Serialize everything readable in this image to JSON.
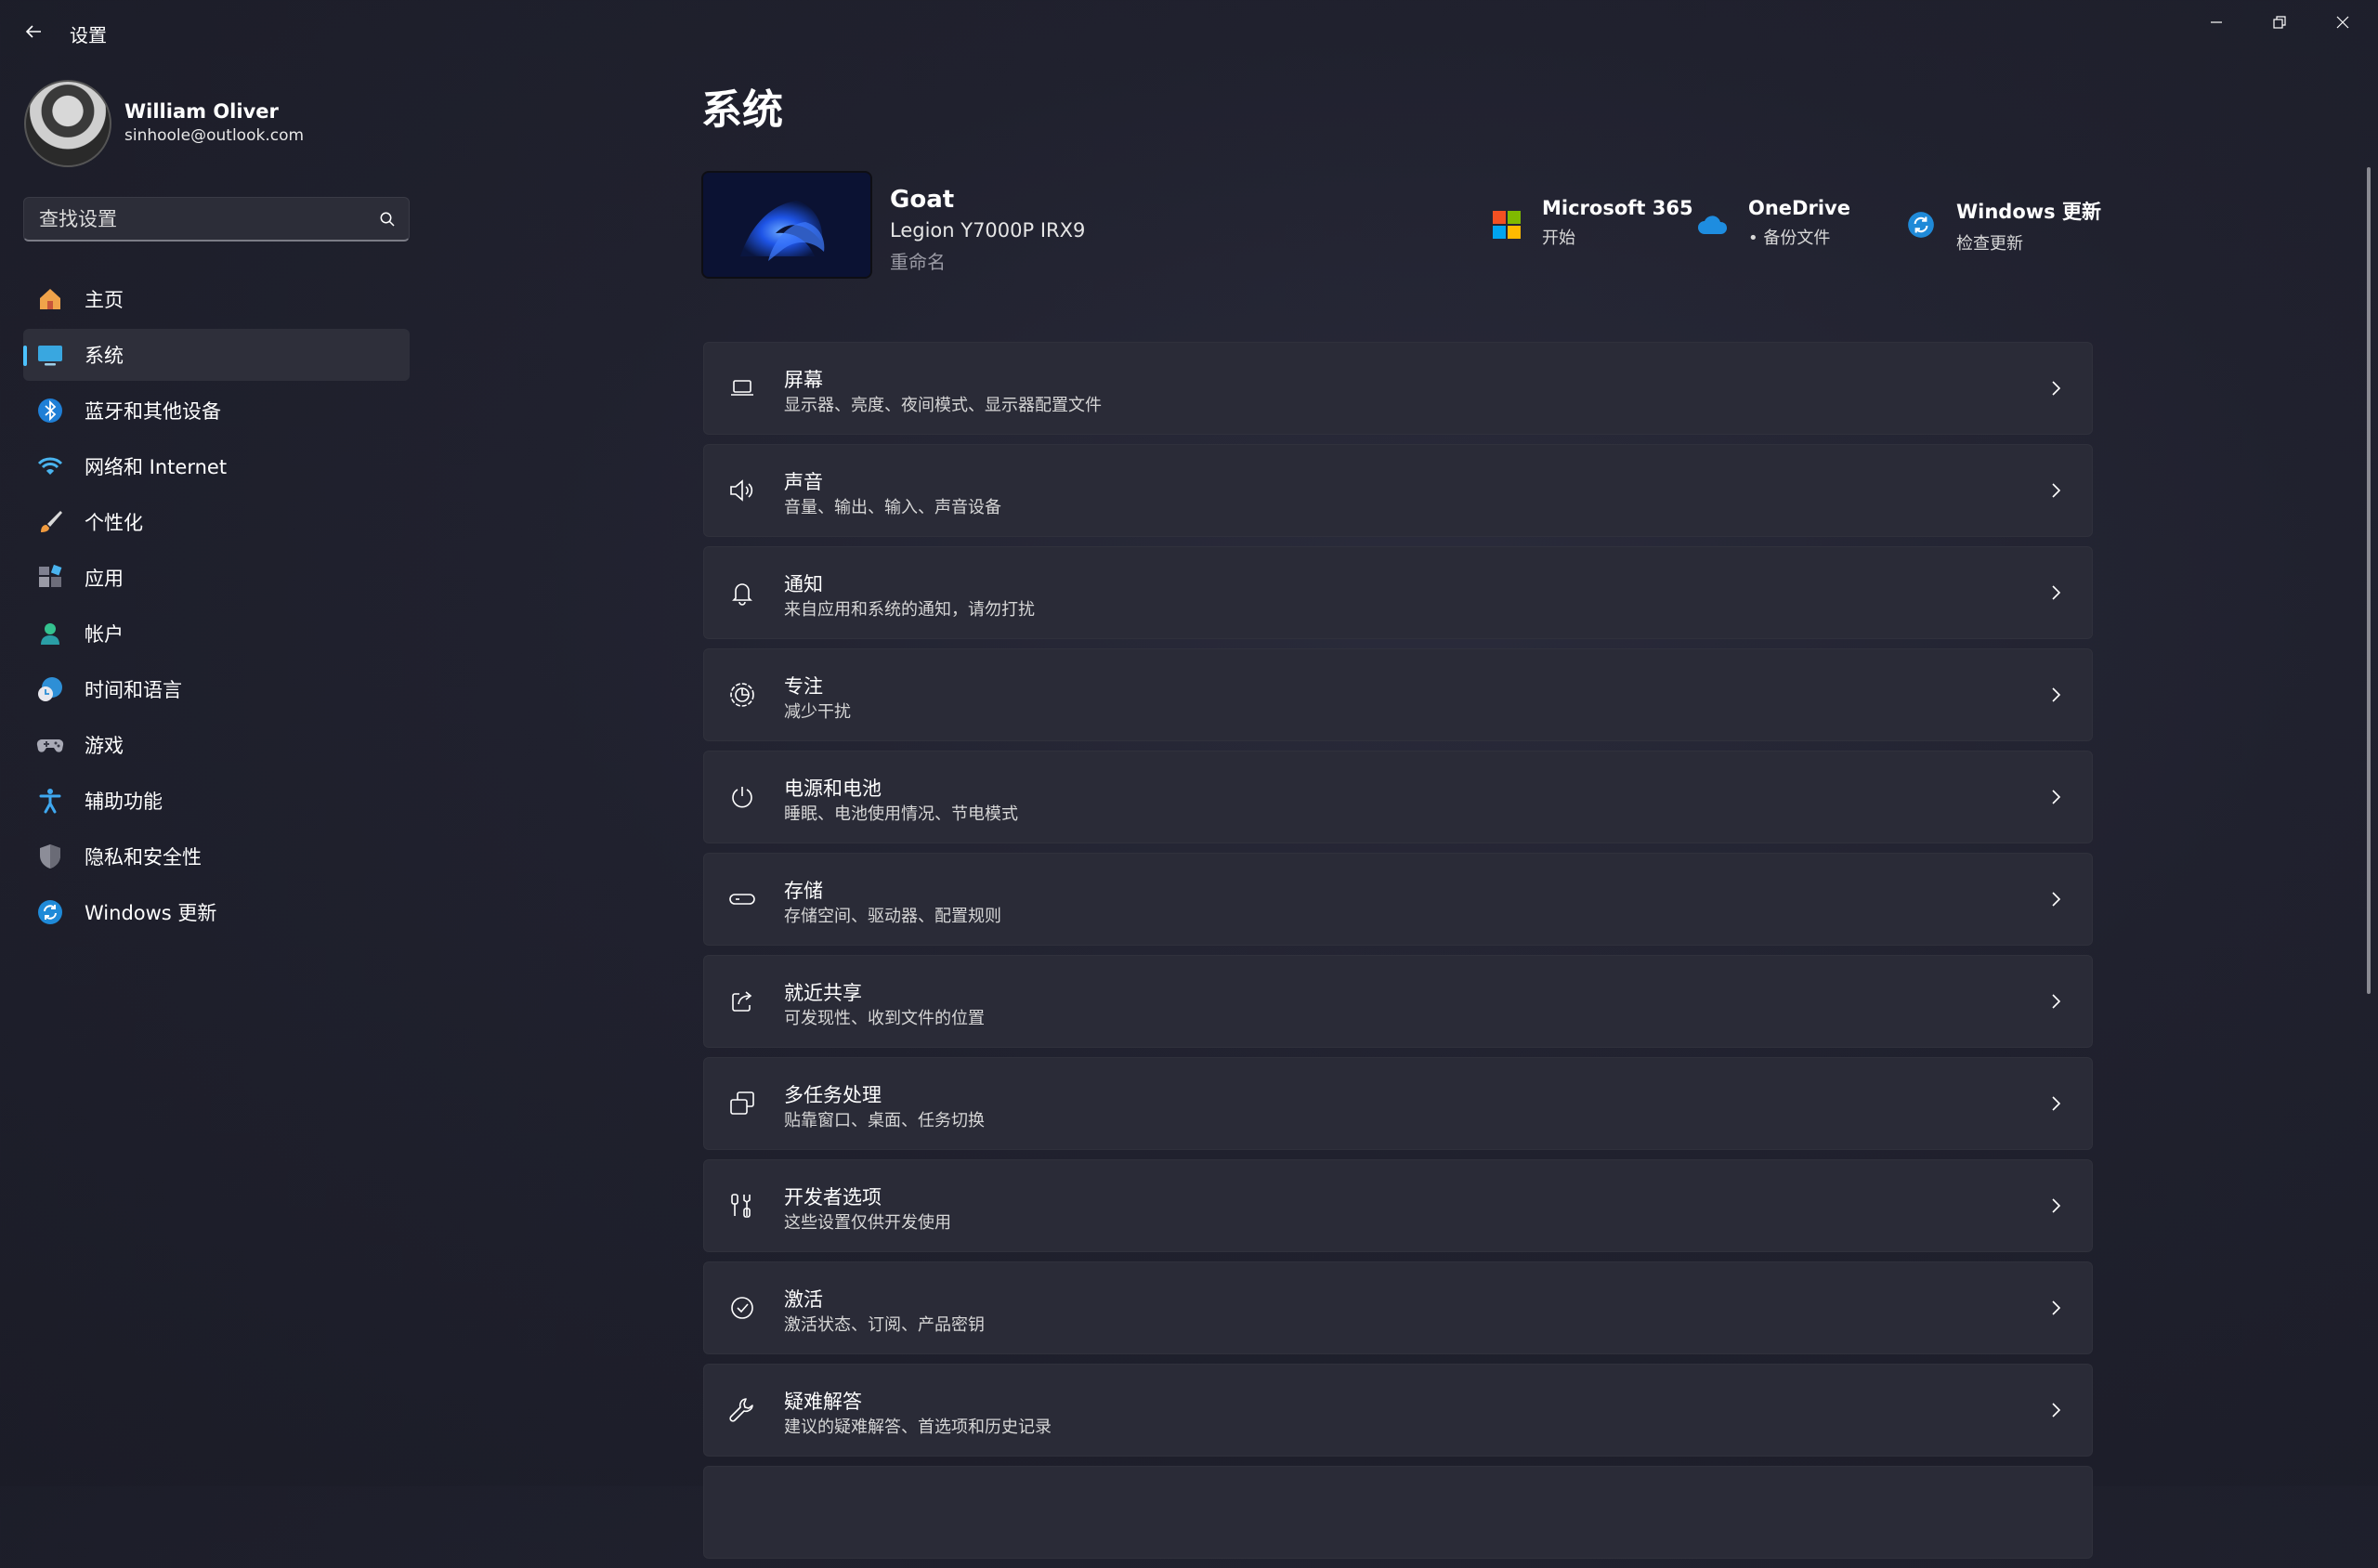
{
  "window": {
    "title": "设置",
    "back_icon": "arrow-left-icon",
    "controls": [
      "minimize-icon",
      "restore-icon",
      "close-icon"
    ]
  },
  "profile": {
    "name": "William Oliver",
    "email": "sinhoole@outlook.com"
  },
  "search": {
    "placeholder": "查找设置",
    "icon": "search-icon"
  },
  "sidebar": {
    "items": [
      {
        "label": "主页",
        "icon": "home-icon",
        "selected": false
      },
      {
        "label": "系统",
        "icon": "monitor-icon",
        "selected": true
      },
      {
        "label": "蓝牙和其他设备",
        "icon": "bluetooth-icon",
        "selected": false
      },
      {
        "label": "网络和 Internet",
        "icon": "wifi-icon",
        "selected": false
      },
      {
        "label": "个性化",
        "icon": "brush-icon",
        "selected": false
      },
      {
        "label": "应用",
        "icon": "apps-icon",
        "selected": false
      },
      {
        "label": "帐户",
        "icon": "person-icon",
        "selected": false
      },
      {
        "label": "时间和语言",
        "icon": "globe-clock-icon",
        "selected": false
      },
      {
        "label": "游戏",
        "icon": "gamepad-icon",
        "selected": false
      },
      {
        "label": "辅助功能",
        "icon": "accessibility-icon",
        "selected": false
      },
      {
        "label": "隐私和安全性",
        "icon": "shield-icon",
        "selected": false
      },
      {
        "label": "Windows 更新",
        "icon": "sync-icon",
        "selected": false
      }
    ]
  },
  "main": {
    "title": "系统",
    "device": {
      "name": "Goat",
      "model": "Legion Y7000P IRX9",
      "rename": "重命名"
    },
    "quick_links": [
      {
        "title": "Microsoft 365",
        "sub": "开始",
        "icon": "microsoft-logo-icon"
      },
      {
        "title": "OneDrive",
        "sub": "• 备份文件",
        "icon": "cloud-icon"
      },
      {
        "title": "Windows 更新",
        "sub": "检查更新",
        "icon": "sync-icon"
      }
    ],
    "cards": [
      {
        "title": "屏幕",
        "sub": "显示器、亮度、夜间模式、显示器配置文件",
        "icon": "laptop-icon"
      },
      {
        "title": "声音",
        "sub": "音量、输出、输入、声音设备",
        "icon": "speaker-icon"
      },
      {
        "title": "通知",
        "sub": "来自应用和系统的通知，请勿打扰",
        "icon": "bell-icon"
      },
      {
        "title": "专注",
        "sub": "减少干扰",
        "icon": "focus-icon"
      },
      {
        "title": "电源和电池",
        "sub": "睡眠、电池使用情况、节电模式",
        "icon": "power-icon"
      },
      {
        "title": "存储",
        "sub": "存储空间、驱动器、配置规则",
        "icon": "drive-icon"
      },
      {
        "title": "就近共享",
        "sub": "可发现性、收到文件的位置",
        "icon": "share-icon"
      },
      {
        "title": "多任务处理",
        "sub": "贴靠窗口、桌面、任务切换",
        "icon": "multitask-icon"
      },
      {
        "title": "开发者选项",
        "sub": "这些设置仅供开发使用",
        "icon": "developer-tools-icon"
      },
      {
        "title": "激活",
        "sub": "激活状态、订阅、产品密钥",
        "icon": "check-circle-icon"
      },
      {
        "title": "疑难解答",
        "sub": "建议的疑难解答、首选项和历史记录",
        "icon": "wrench-icon"
      }
    ]
  },
  "colors": {
    "accent": "#4cc2ff",
    "background": "#20212e",
    "card": "#2a2b37"
  }
}
